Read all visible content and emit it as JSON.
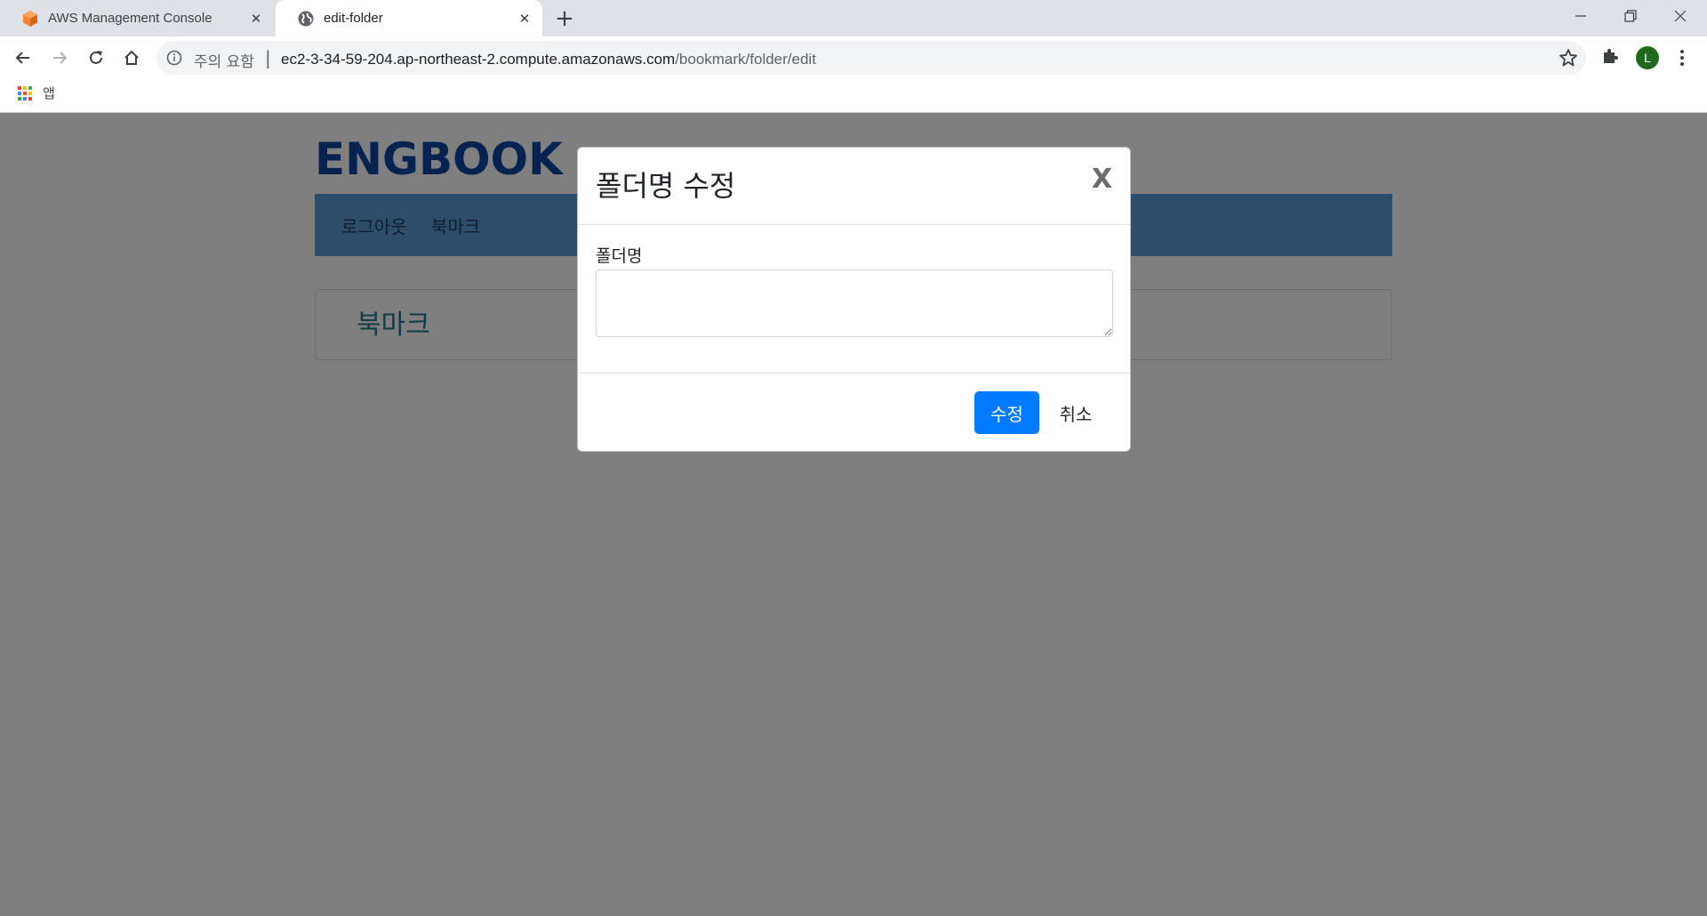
{
  "browser": {
    "tabs": [
      {
        "title": "AWS Management Console",
        "icon": "aws-cube-icon",
        "active": false
      },
      {
        "title": "edit-folder",
        "icon": "globe-icon",
        "active": true
      }
    ],
    "omnibox": {
      "security_label": "주의 요함",
      "separator": "|",
      "url_host": "ec2-3-34-59-204.ap-northeast-2.compute.amazonaws.com",
      "url_path": "/bookmark/folder/edit"
    },
    "profile_initial": "L",
    "bookmarks_bar": {
      "apps_label": "앱"
    }
  },
  "page": {
    "brand": "ENGBOOK",
    "nav": {
      "logout": "로그아웃",
      "bookmark": "북마크"
    },
    "card_heading": "북마크"
  },
  "modal": {
    "title": "폴더명 수정",
    "close_label": "X",
    "field_label": "폴더명",
    "field_value": "",
    "submit_label": "수정",
    "cancel_label": "취소"
  },
  "colors": {
    "brand": "#0d47a1",
    "navbar": "#5b9bd5",
    "primary_button": "#007bff",
    "backdrop": "rgba(0,0,0,0.5)",
    "avatar": "#1e6b1e"
  }
}
